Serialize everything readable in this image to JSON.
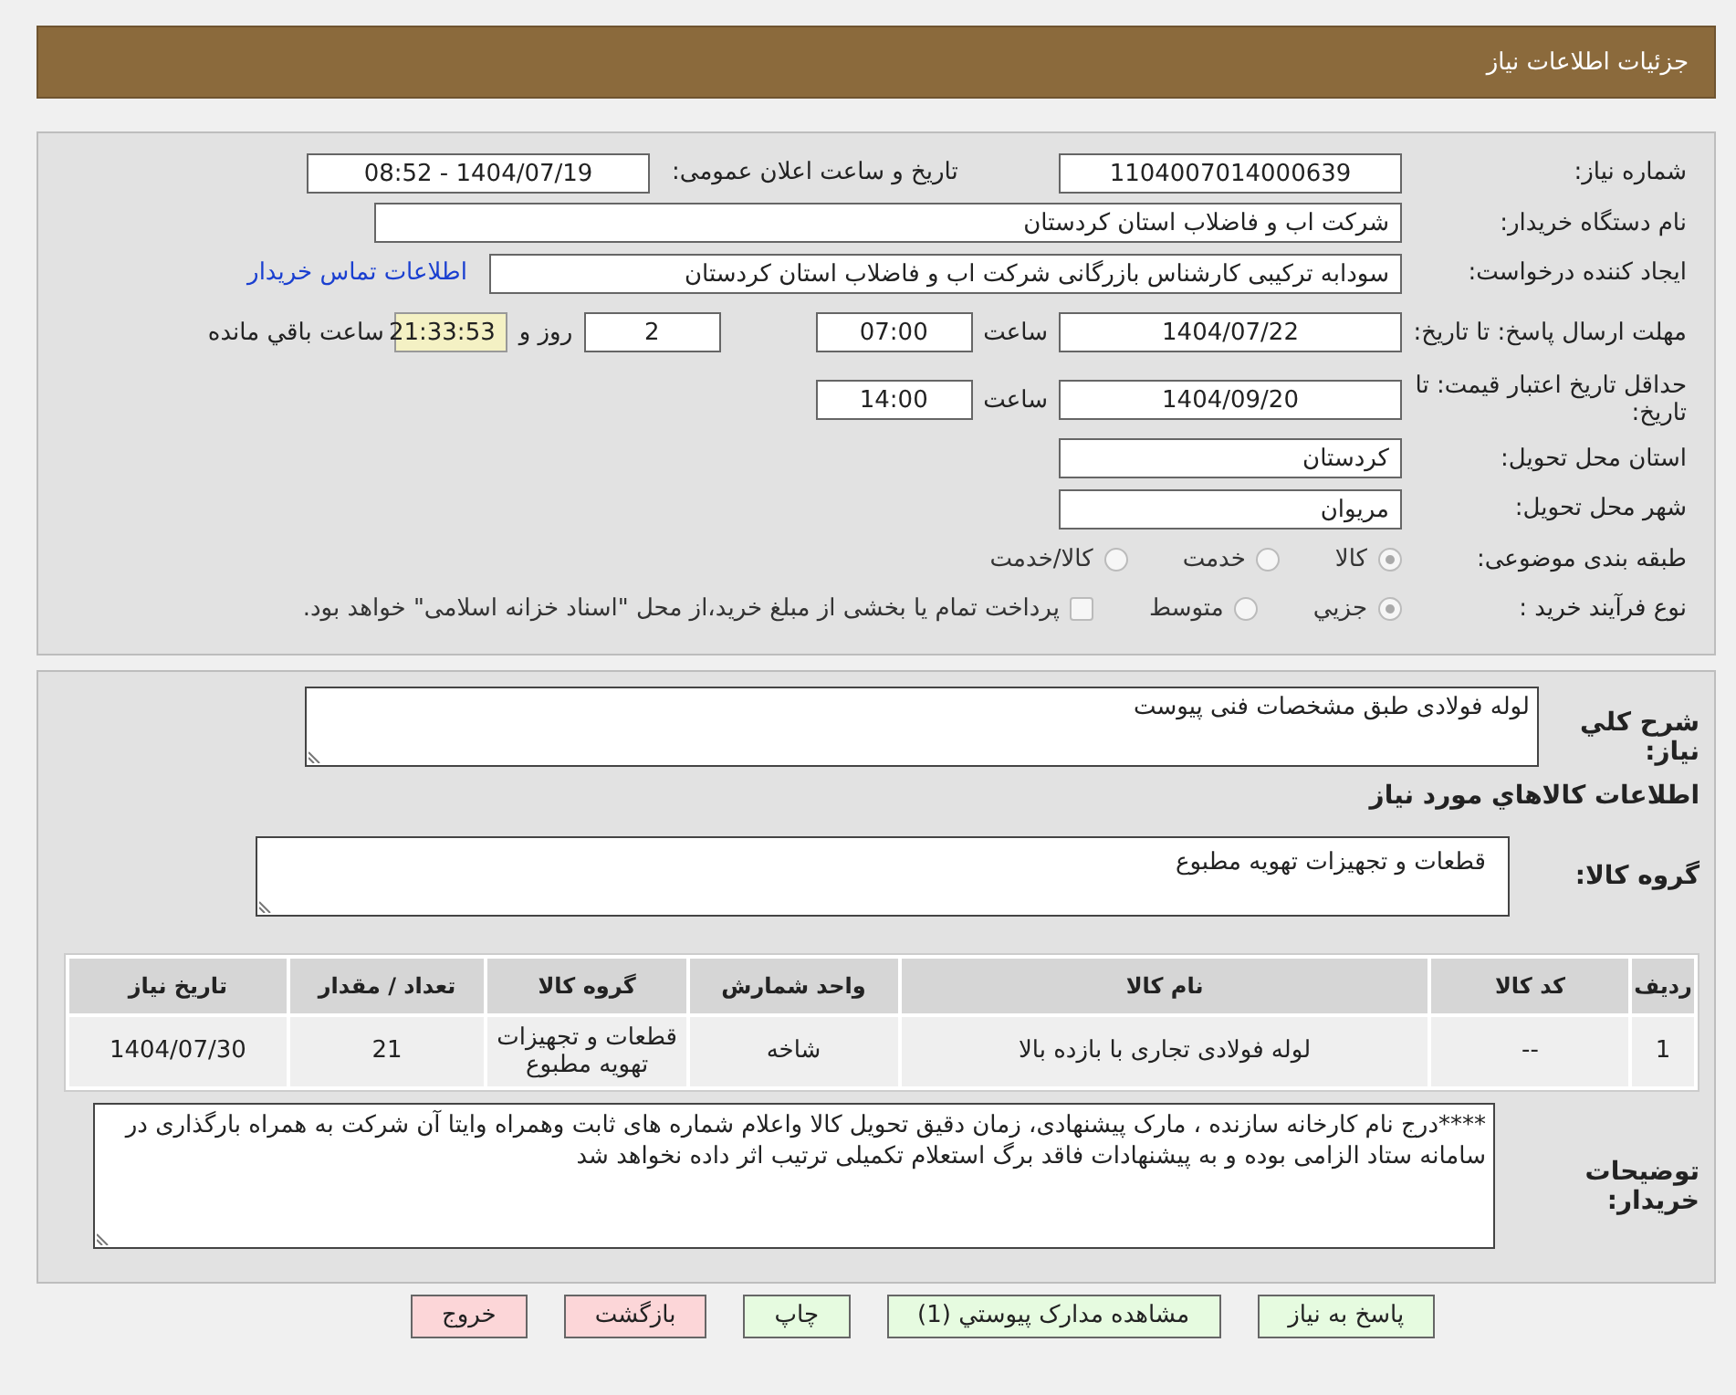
{
  "header": {
    "title": "جزئیات اطلاعات نیاز"
  },
  "need_number": {
    "label": "شماره نیاز:",
    "value": "1104007014000639"
  },
  "announce": {
    "label": "تاریخ و ساعت اعلان عمومی:",
    "value": "1404/07/19 - 08:52"
  },
  "buyer": {
    "label": "نام دستگاه خریدار:",
    "value": "شرکت اب و فاضلاب استان کردستان"
  },
  "creator": {
    "label": "ایجاد کننده درخواست:",
    "value": "سودابه ترکیبی کارشناس بازرگانی شرکت اب و فاضلاب استان کردستان",
    "link": "اطلاعات تماس خریدار"
  },
  "deadline": {
    "label": "مهلت ارسال پاسخ: تا تاریخ:",
    "date": "1404/07/22",
    "time_label": "ساعت",
    "time": "07:00",
    "days": "2",
    "days_label": "روز و",
    "remaining": "21:33:53",
    "remaining_label": "ساعت باقي مانده"
  },
  "validity": {
    "label": "حداقل تاریخ اعتبار قیمت: تا تاریخ:",
    "date": "1404/09/20",
    "time_label": "ساعت",
    "time": "14:00"
  },
  "province": {
    "label": "استان محل تحویل:",
    "value": "کردستان"
  },
  "city": {
    "label": "شهر محل تحویل:",
    "value": "مریوان"
  },
  "category": {
    "label": "طبقه بندی موضوعی:",
    "options": [
      {
        "label": "کالا",
        "selected": true
      },
      {
        "label": "خدمت",
        "selected": false
      },
      {
        "label": "کالا/خدمت",
        "selected": false
      }
    ]
  },
  "process": {
    "label": "نوع فرآیند خرید :",
    "options": [
      {
        "label": "جزيي",
        "selected": true
      },
      {
        "label": "متوسط",
        "selected": false
      }
    ],
    "payment": {
      "label": "پرداخت تمام یا بخشی از مبلغ خرید،از محل \"اسناد خزانه اسلامی\" خواهد بود.",
      "checked": false
    }
  },
  "description": {
    "label": "شرح کلي نياز:",
    "value": "لوله فولادی طبق مشخصات فنی پیوست"
  },
  "goods_heading": "اطلاعات کالاهاي مورد نياز",
  "group": {
    "label": "گروه کالا:",
    "value": "قطعات و تجهیزات تهویه مطبوع"
  },
  "table": {
    "columns": [
      "رديف",
      "کد کالا",
      "نام کالا",
      "واحد شمارش",
      "گروه کالا",
      "تعداد / مقدار",
      "تاریخ نیاز"
    ],
    "rows": [
      [
        "1",
        "--",
        "لوله فولادی تجاری با بازده بالا",
        "شاخه",
        "قطعات و تجهیزات تهویه مطبوع",
        "21",
        "1404/07/30"
      ]
    ]
  },
  "buyer_notes": {
    "label": "توضیحات خریدار:",
    "value": "****درج نام کارخانه سازنده ، مارک پیشنهادی، زمان دقیق تحویل کالا واعلام شماره های ثابت وهمراه وایتا آن شرکت به همراه بارگذاری در سامانه ستاد الزامی بوده و به پیشنهادات فاقد برگ استعلام تکمیلی ترتیب اثر داده نخواهد شد"
  },
  "buttons": [
    {
      "label": "پاسخ به نياز",
      "kind": "action"
    },
    {
      "label": "مشاهده مدارک پيوستي (1)",
      "kind": "action"
    },
    {
      "label": "چاپ",
      "kind": "action"
    },
    {
      "label": "بازگشت",
      "kind": "exit"
    },
    {
      "label": "خروج",
      "kind": "exit"
    }
  ]
}
